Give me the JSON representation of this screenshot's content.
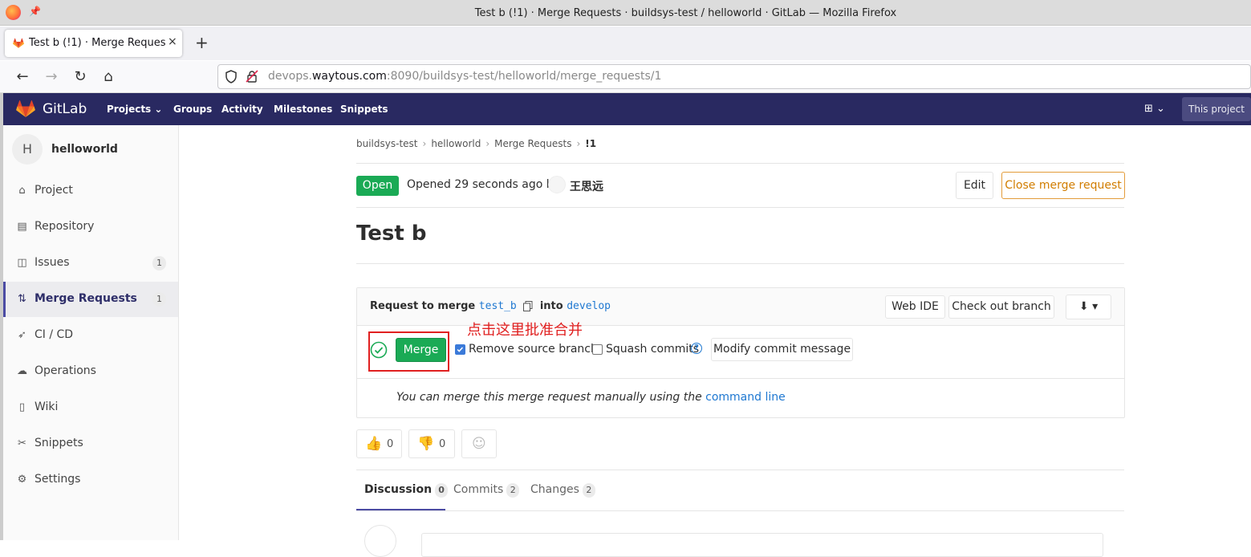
{
  "browser": {
    "window_title": "Test b (!1) · Merge Requests · buildsys-test / helloworld · GitLab — Mozilla Firefox",
    "tab_label": "Test b (!1) · Merge Requests",
    "tab_close": "×",
    "new_tab": "+",
    "url_host_prefix": "devops.",
    "url_host": "waytous.com",
    "url_rest": ":8090/buildsys-test/helloworld/merge_requests/1"
  },
  "gitlab": {
    "brand": "GitLab",
    "nav": {
      "projects": "Projects ⌄",
      "groups": "Groups",
      "activity": "Activity",
      "milestones": "Milestones",
      "snippets": "Snippets"
    },
    "plus": "⊞ ⌄",
    "search_placeholder": "This project"
  },
  "sidebar": {
    "project_initial": "H",
    "project_name": "helloworld",
    "items": [
      {
        "label": "Project",
        "icon": "home-icon",
        "glyph": "⌂"
      },
      {
        "label": "Repository",
        "icon": "book-icon",
        "glyph": "▤"
      },
      {
        "label": "Issues",
        "icon": "issues-icon",
        "glyph": "◫",
        "count": "1"
      },
      {
        "label": "Merge Requests",
        "icon": "merge-request-icon",
        "glyph": "⇅",
        "count": "1"
      },
      {
        "label": "CI / CD",
        "icon": "rocket-icon",
        "glyph": "➶"
      },
      {
        "label": "Operations",
        "icon": "cloud-gear-icon",
        "glyph": "☁"
      },
      {
        "label": "Wiki",
        "icon": "book-closed-icon",
        "glyph": "▯"
      },
      {
        "label": "Snippets",
        "icon": "scissors-icon",
        "glyph": "✂"
      },
      {
        "label": "Settings",
        "icon": "gear-icon",
        "glyph": "⚙"
      }
    ]
  },
  "breadcrumb": {
    "group": "buildsys-test",
    "project": "helloworld",
    "section": "Merge Requests",
    "current": "!1",
    "sep": "›"
  },
  "mr": {
    "status": "Open",
    "opened_text": "Opened 29 seconds ago by",
    "author": "王思远",
    "edit_label": "Edit",
    "close_label": "Close merge request",
    "title": "Test b"
  },
  "widget": {
    "request_prefix": "Request to merge",
    "source_branch": "test_b",
    "into": "into",
    "target_branch": "develop",
    "web_ide": "Web IDE",
    "checkout": "Check out branch",
    "download": "⬇ ▾",
    "merge_label": "Merge",
    "remove_source": "Remove source branch",
    "squash": "Squash commits",
    "help": "?",
    "modify_commit": "Modify commit message",
    "manual_text": "You can merge this merge request manually using the",
    "manual_link": "command line",
    "annotation": "点击这里批准合并"
  },
  "awards": {
    "thumbs_up": "0",
    "thumbs_down": "0"
  },
  "tabs": {
    "discussion": "Discussion",
    "discussion_count": "0",
    "commits": "Commits",
    "commits_count": "2",
    "changes": "Changes",
    "changes_count": "2"
  },
  "colors": {
    "header_bg": "#292961",
    "open_badge": "#1aaa55",
    "merge_button": "#1aaa55",
    "link": "#1f78d1",
    "annotation_red": "#e02020",
    "close_button_border": "#e39c3a"
  }
}
